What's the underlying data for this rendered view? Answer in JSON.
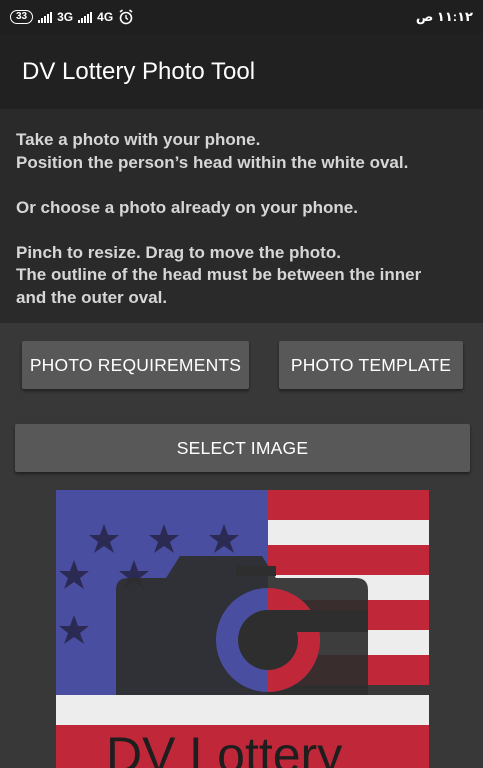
{
  "status_bar": {
    "battery": "33",
    "network1": "3G",
    "network2": "4G",
    "time": "١١:١٢ ص",
    "alarm_icon": "alarm-clock-icon"
  },
  "app_bar": {
    "title": "DV Lottery Photo Tool"
  },
  "instructions": {
    "line1": "Take a photo with your phone.",
    "line2": "Position the person’s head within the white oval.",
    "line3": "Or choose a photo already on your phone.",
    "line4": "Pinch to resize. Drag to move the photo.",
    "line5": "The outline of the head must be between the inner",
    "line6": "and the outer oval."
  },
  "buttons": {
    "photo_requirements": "PHOTO REQUIREMENTS",
    "photo_template": "PHOTO TEMPLATE",
    "select_image": "SELECT IMAGE"
  },
  "logo": {
    "text": "DV Lottery",
    "colors": {
      "blue": "#4a4ea0",
      "red": "#c0283a",
      "white": "#ededed",
      "dark": "#2e2e2e"
    }
  }
}
